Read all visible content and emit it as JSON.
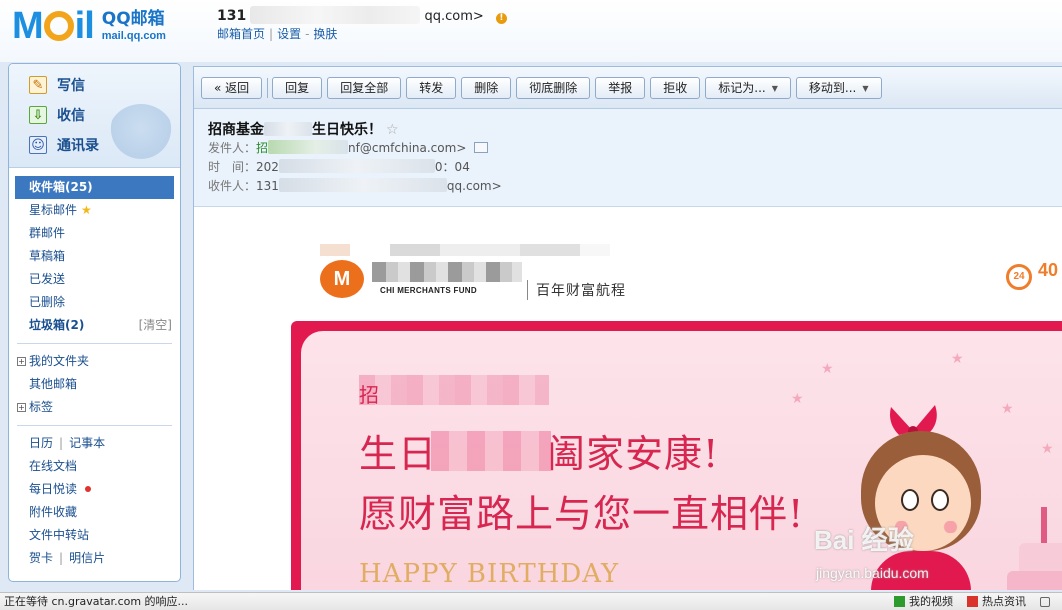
{
  "brand": {
    "logo_text_m": "M",
    "logo_text_il": "il",
    "name_cn": "QQ邮箱",
    "url": "mail.qq.com"
  },
  "account": {
    "prefix": "131",
    "suffix": "qq.com>",
    "warn_icon": "warning-icon",
    "links": [
      "邮箱首页",
      "设置",
      "换肤"
    ]
  },
  "sidebar": {
    "actions": [
      {
        "label": "写信",
        "icon": "compose-icon"
      },
      {
        "label": "收信",
        "icon": "inbox-download-icon"
      },
      {
        "label": "通讯录",
        "icon": "contacts-icon"
      }
    ],
    "folders": {
      "inbox": "收件箱(25)",
      "starred": "星标邮件",
      "group": "群邮件",
      "drafts": "草稿箱",
      "sent": "已发送",
      "deleted": "已删除",
      "spam": "垃圾箱(2)",
      "spam_clear": "[清空]",
      "my_folders": "我的文件夹",
      "other_mail": "其他邮箱",
      "tags": "标签",
      "calendar": "日历",
      "notes": "记事本",
      "online_docs": "在线文档",
      "daily_read": "每日悦读",
      "attachments": "附件收藏",
      "file_transfer": "文件中转站",
      "cards": "贺卡",
      "postcards": "明信片"
    }
  },
  "toolbar": {
    "back": "« 返回",
    "reply": "回复",
    "reply_all": "回复全部",
    "forward": "转发",
    "delete": "删除",
    "delete_forever": "彻底删除",
    "report": "举报",
    "reject": "拒收",
    "mark_as": "标记为...",
    "move_to": "移动到..."
  },
  "message": {
    "subject_start": "招商基金",
    "subject_end": "生日快乐！",
    "sender_label": "发件人：",
    "sender_name_start": "招",
    "sender_email_end": "nf@cmfchina.com>",
    "time_label": "时　间：",
    "time_start": "202",
    "time_end": "0：04",
    "to_label": "收件人：",
    "to_start": "131",
    "to_end": "qq.com>"
  },
  "email_body": {
    "company_logo": "M",
    "company_en": "CHI     MERCHANTS FUND",
    "slogan": "百年财富航程",
    "hotline": "40",
    "hotline_icon": "24",
    "greet_lead": "招",
    "line1_start": "生日",
    "line1_end": "阖家安康!",
    "line2": "愿财富路上与您一直相伴!",
    "hbd": "HAPPY BIRTHDAY"
  },
  "watermark": {
    "main": "Bai 经验",
    "sub": "jingyan.baidu.com"
  },
  "statusbar": {
    "text": "正在等待 cn.gravatar.com 的响应...",
    "video": "我的视频",
    "news": "热点资讯"
  },
  "colors": {
    "brand_blue": "#1a74c8",
    "accent_orange": "#f2a51b",
    "inbox_active": "#3b78c0",
    "card_red": "#e2194e",
    "card_text": "#d7264f"
  }
}
